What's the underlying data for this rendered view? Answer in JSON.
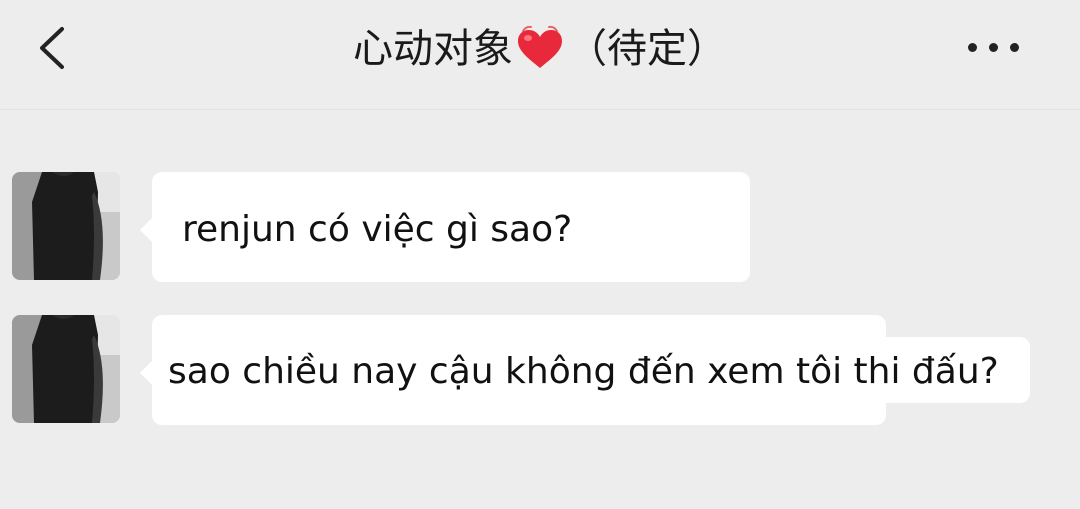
{
  "header": {
    "title_prefix": "心动对象",
    "title_suffix": "（待定）",
    "heart_icon": "heart-icon",
    "back_icon": "chevron-left-icon",
    "more_icon": "more-horizontal-icon"
  },
  "messages": [
    {
      "text": "renjun có việc gì sao?"
    },
    {
      "text": "sao chiều nay cậu không đến xem tôi thi đấu?"
    }
  ],
  "colors": {
    "background": "#ededed",
    "bubble": "#ffffff",
    "heart": "#e8293b"
  }
}
